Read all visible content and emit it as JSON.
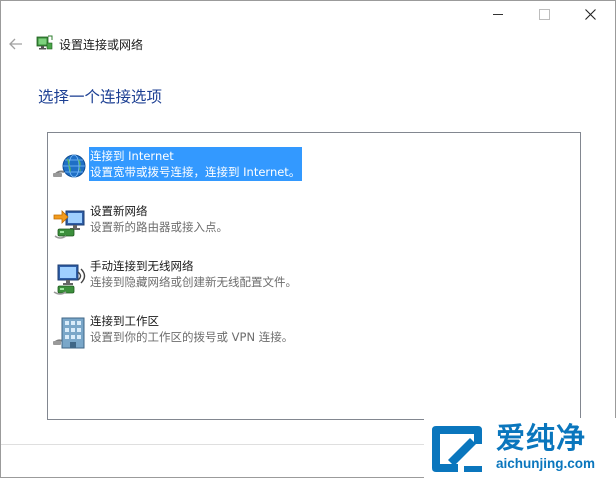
{
  "window": {
    "title": "设置连接或网络"
  },
  "page": {
    "heading": "选择一个连接选项"
  },
  "options": [
    {
      "title": "连接到 Internet",
      "description": "设置宽带或拨号连接，连接到 Internet。",
      "icon": "globe-network-icon",
      "selected": true
    },
    {
      "title": "设置新网络",
      "description": "设置新的路由器或接入点。",
      "icon": "new-network-icon",
      "selected": false
    },
    {
      "title": "手动连接到无线网络",
      "description": "连接到隐藏网络或创建新无线配置文件。",
      "icon": "wireless-network-icon",
      "selected": false
    },
    {
      "title": "连接到工作区",
      "description": "设置到你的工作区的拨号或 VPN 连接。",
      "icon": "workplace-icon",
      "selected": false
    }
  ],
  "watermark": {
    "brand": "爱纯净",
    "url": "aichunjing.com"
  },
  "colors": {
    "accent": "#1c3f93",
    "selection": "#3399ff",
    "watermark": "#0a76bd"
  }
}
